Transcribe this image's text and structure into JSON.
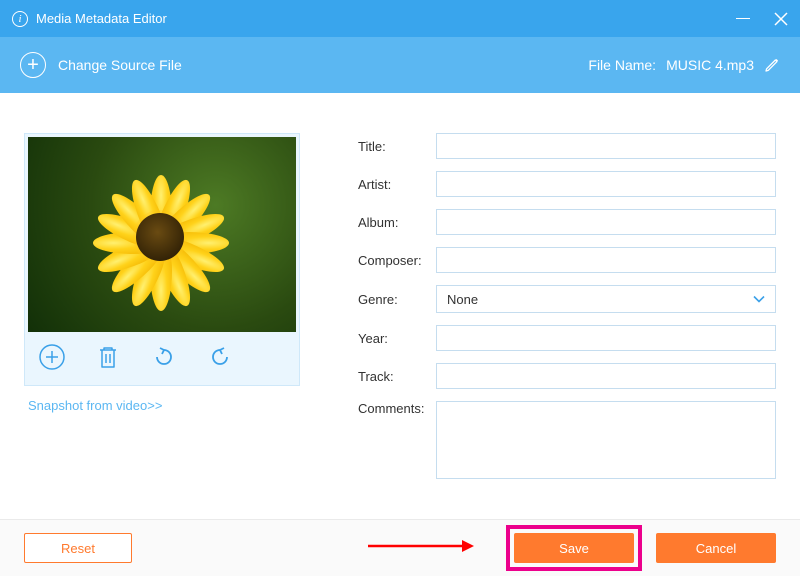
{
  "titlebar": {
    "title": "Media Metadata Editor"
  },
  "toolbar": {
    "change_source": "Change Source File",
    "filename_label": "File Name:",
    "filename_value": "MUSIC 4.mp3"
  },
  "thumb": {
    "snapshot_link": "Snapshot from video>>"
  },
  "form": {
    "title_label": "Title:",
    "artist_label": "Artist:",
    "album_label": "Album:",
    "composer_label": "Composer:",
    "genre_label": "Genre:",
    "genre_value": "None",
    "year_label": "Year:",
    "track_label": "Track:",
    "comments_label": "Comments:",
    "title_value": "",
    "artist_value": "",
    "album_value": "",
    "composer_value": "",
    "year_value": "",
    "track_value": "",
    "comments_value": ""
  },
  "footer": {
    "reset": "Reset",
    "save": "Save",
    "cancel": "Cancel"
  }
}
